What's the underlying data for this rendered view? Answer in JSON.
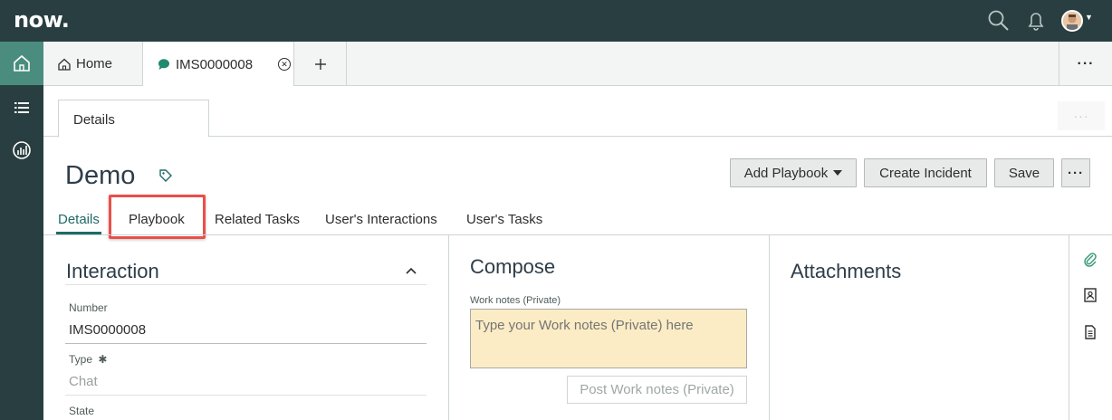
{
  "brand": {
    "logo_text": "now."
  },
  "colors": {
    "header_bg": "#293e40",
    "accent": "#1f6b69",
    "rail_active": "#4a8d7e",
    "highlight": "#ea4f4a",
    "worknotes_bg": "#fbecc5"
  },
  "header_icons": [
    "search-icon",
    "bell-icon",
    "avatar"
  ],
  "rail": [
    "home-icon",
    "list-icon",
    "analytics-icon"
  ],
  "tabs": {
    "home_label": "Home",
    "record_label": "IMS0000008",
    "more_label": "···"
  },
  "subnav": {
    "details_label": "Details",
    "more_label": "···"
  },
  "record": {
    "title": "Demo",
    "buttons": {
      "add_playbook": "Add Playbook",
      "create_incident": "Create Incident",
      "save": "Save",
      "more": "···"
    },
    "related_tabs": [
      "Details",
      "Playbook",
      "Related Tasks",
      "User's Interactions",
      "User's Tasks"
    ]
  },
  "interaction": {
    "heading": "Interaction",
    "number_label": "Number",
    "number_value": "IMS0000008",
    "type_label": "Type",
    "type_required": "✱",
    "type_value": "Chat",
    "state_label": "State"
  },
  "compose": {
    "heading": "Compose",
    "worknotes_label": "Work notes (Private)",
    "worknotes_placeholder": "Type your Work notes (Private) here",
    "post_button": "Post Work notes (Private)"
  },
  "attachments": {
    "heading": "Attachments"
  },
  "side_icons": [
    "paperclip-icon",
    "contact-card-icon",
    "document-icon"
  ]
}
